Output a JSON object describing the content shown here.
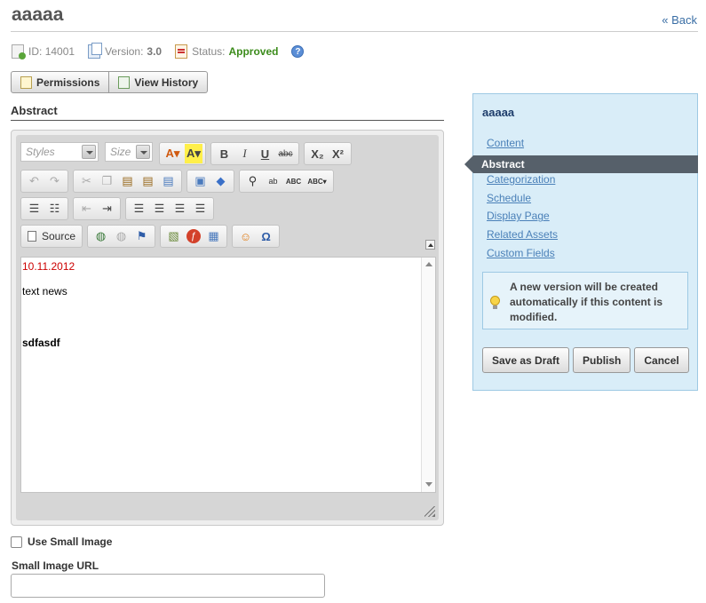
{
  "page": {
    "title": "aaaaa",
    "back_label": "« Back"
  },
  "meta": {
    "id_label": "ID:",
    "id_value": "14001",
    "version_label": "Version:",
    "version_value": "3.0",
    "status_label": "Status:",
    "status_value": "Approved",
    "help_glyph": "?"
  },
  "actions": {
    "permissions_label": "Permissions",
    "view_history_label": "View History"
  },
  "section": {
    "heading": "Abstract"
  },
  "editor": {
    "styles_placeholder": "Styles",
    "size_placeholder": "Size",
    "source_label": "Source",
    "toolbar_icons": {
      "bold": "B",
      "italic": "I",
      "underline": "U",
      "strike": "abc",
      "subscript": "X₂",
      "superscript": "X²",
      "undo": "↶",
      "redo": "↷",
      "numbered_list": "☰",
      "bulleted_list": "☷",
      "outdent": "⇤",
      "indent": "⇥",
      "align_left": "☰",
      "align_center": "☰",
      "align_right": "☰",
      "justify": "☰",
      "special_char": "Ω",
      "smiley": "☺",
      "flash": "ƒ",
      "table": "▦",
      "find": "⚲",
      "spell1": "ABC",
      "spell2": "ABC",
      "spell3": "ABC"
    },
    "content": {
      "date": "10.11.2012",
      "line1": "text news",
      "line2": "sdfasdf"
    }
  },
  "form": {
    "use_small_image_label": "Use Small Image",
    "use_small_image_checked": false,
    "small_image_url_label": "Small Image URL",
    "small_image_url_value": ""
  },
  "sidebar": {
    "title": "aaaaa",
    "nav": [
      {
        "label": "Content",
        "active": false
      },
      {
        "label": "Abstract",
        "active": true
      },
      {
        "label": "Categorization",
        "active": false
      },
      {
        "label": "Schedule",
        "active": false
      },
      {
        "label": "Display Page",
        "active": false
      },
      {
        "label": "Related Assets",
        "active": false
      },
      {
        "label": "Custom Fields",
        "active": false
      }
    ],
    "notice": "A new version will be created automatically if this content is modified.",
    "buttons": {
      "save_draft": "Save as Draft",
      "publish": "Publish",
      "cancel": "Cancel"
    }
  },
  "colors": {
    "accent_link": "#3a6ea5",
    "status_approved": "#3c8c1c",
    "sidebar_bg": "#d9edf8",
    "active_nav_bg": "#56606a",
    "date_text": "#cc0000"
  }
}
